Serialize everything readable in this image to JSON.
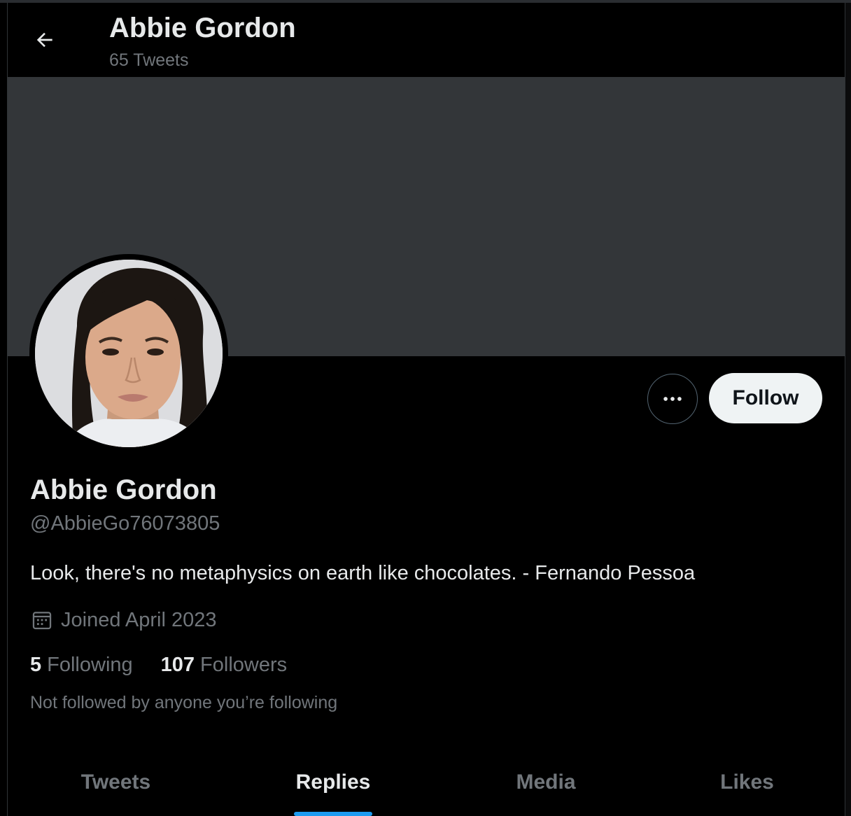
{
  "header": {
    "title": "Abbie Gordon",
    "tweet_count": "65 Tweets",
    "back_icon": "arrow-left-icon"
  },
  "profile": {
    "display_name": "Abbie Gordon",
    "handle": "@AbbieGo76073805",
    "bio": "Look, there's no metaphysics on earth like chocolates. - Fernando Pessoa",
    "joined": "Joined April 2023",
    "following_count": "5",
    "following_label": "Following",
    "followers_count": "107",
    "followers_label": "Followers",
    "not_followed": "Not followed by anyone you’re following"
  },
  "actions": {
    "follow_label": "Follow",
    "more_icon": "more-options-icon"
  },
  "tabs": [
    {
      "label": "Tweets",
      "active": false
    },
    {
      "label": "Replies",
      "active": true
    },
    {
      "label": "Media",
      "active": false
    },
    {
      "label": "Likes",
      "active": false
    }
  ],
  "colors": {
    "background": "#000000",
    "banner": "#333639",
    "accent": "#1d9bf0",
    "primary_text": "#e7e9ea",
    "secondary_text": "#71767b",
    "follow_button_bg": "#eff3f4"
  }
}
